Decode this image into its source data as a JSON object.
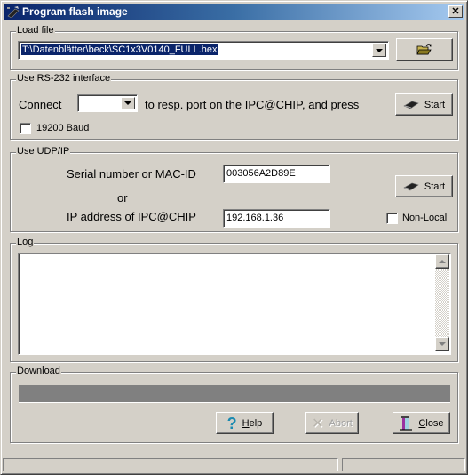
{
  "window": {
    "title": "Program flash image",
    "close_icon": "close-icon",
    "app_icon": "flash-chip-icon"
  },
  "load_file": {
    "group_label": "Load file",
    "path_value": "T:\\Datenblätter\\beck\\SC1x3V0140_FULL.hex",
    "browse_icon": "open-folder-icon"
  },
  "rs232": {
    "group_label": "Use RS-232 interface",
    "connect_label": "Connect",
    "port_value": "",
    "instruction": "to resp. port on the IPC@CHIP, and press",
    "start_label": "Start",
    "baud_label": "19200 Baud",
    "baud_checked": false
  },
  "udp": {
    "group_label": "Use UDP/IP",
    "serial_label": "Serial number or MAC-ID",
    "or_label": "or",
    "ip_label": "IP address of IPC@CHIP",
    "serial_value": "003056A2D89E",
    "ip_value": "192.168.1.36",
    "start_label": "Start",
    "nonlocal_label": "Non-Local",
    "nonlocal_checked": false
  },
  "log": {
    "group_label": "Log",
    "content": ""
  },
  "download": {
    "group_label": "Download",
    "progress_percent": 0
  },
  "buttons": {
    "help_label": "Help",
    "help_mnemonic": "H",
    "abort_label": "Abort",
    "abort_enabled": false,
    "close_label": "Close",
    "close_mnemonic": "C"
  },
  "statusbar": {
    "left_text": "",
    "right_text": ""
  }
}
